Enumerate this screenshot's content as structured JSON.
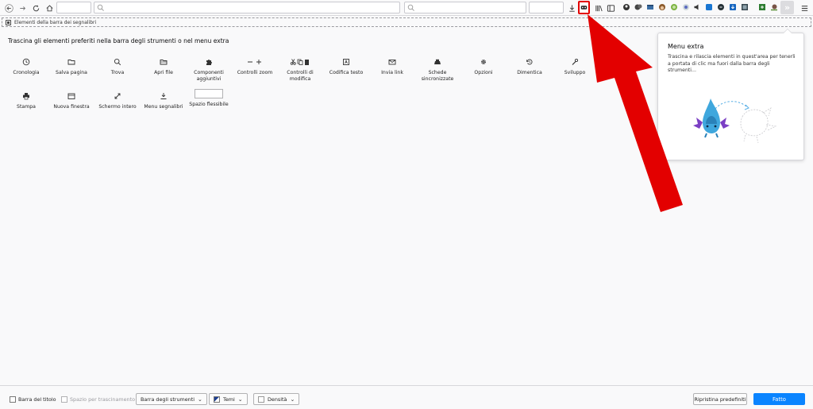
{
  "toolbar": {
    "url_placeholder": "",
    "search_placeholder": "",
    "menu_icon": "hamburger-menu-icon"
  },
  "bookmarks_bar": {
    "label": "Elementi della barra dei segnalibri"
  },
  "instructions": "Trascina gli elementi preferiti nella barra degli strumenti o nel menu extra",
  "palette": [
    {
      "name": "cronologia",
      "label": "Cronologia",
      "icon": "clock-icon"
    },
    {
      "name": "salva-pagina",
      "label": "Salva pagina",
      "icon": "folder-icon"
    },
    {
      "name": "trova",
      "label": "Trova",
      "icon": "search-icon"
    },
    {
      "name": "apri-file",
      "label": "Apri file",
      "icon": "open-folder-icon"
    },
    {
      "name": "componenti-aggiuntivi",
      "label": "Componenti aggiuntivi",
      "icon": "puzzle-icon"
    },
    {
      "name": "controlli-zoom",
      "label": "Controlli zoom",
      "icon": "zoom-icon"
    },
    {
      "name": "controlli-modifica",
      "label": "Controlli di modifica",
      "icon": "cut-copy-paste-icon"
    },
    {
      "name": "codifica-testo",
      "label": "Codifica testo",
      "icon": "text-encoding-icon"
    },
    {
      "name": "invia-link",
      "label": "Invia link",
      "icon": "mail-icon"
    },
    {
      "name": "schede-sincronizzate",
      "label": "Schede sincronizzate",
      "icon": "synced-tabs-icon"
    },
    {
      "name": "opzioni",
      "label": "Opzioni",
      "icon": "gear-icon"
    },
    {
      "name": "dimentica",
      "label": "Dimentica",
      "icon": "forget-icon"
    },
    {
      "name": "sviluppo",
      "label": "Sviluppo",
      "icon": "wrench-icon"
    },
    {
      "name": "stampa",
      "label": "Stampa",
      "icon": "printer-icon"
    },
    {
      "name": "nuova-finestra",
      "label": "Nuova finestra",
      "icon": "new-window-icon"
    },
    {
      "name": "schermo-intero",
      "label": "Schermo intero",
      "icon": "fullscreen-icon"
    },
    {
      "name": "menu-segnalibri",
      "label": "Menu segnalibri",
      "icon": "bookmarks-menu-icon"
    },
    {
      "name": "spazio-flessibile",
      "label": "Spazio flessibile",
      "icon": "flexible-space-icon"
    }
  ],
  "overflow_panel": {
    "title": "Menu extra",
    "description": "Trascina e rilascia elementi in quest'area per tenerli a portata di clic ma fuori dalla barra degli strumenti..."
  },
  "footer": {
    "title_bar_label": "Barra del titolo",
    "drag_space_label": "Spazio per trascinamento",
    "toolbars_label": "Barra degli strumenti",
    "themes_label": "Temi",
    "density_label": "Densità",
    "restore_label": "Ripristina predefiniti",
    "done_label": "Fatto"
  },
  "colors": {
    "accent_blue": "#0a84ff",
    "highlight_red": "#e30000"
  }
}
